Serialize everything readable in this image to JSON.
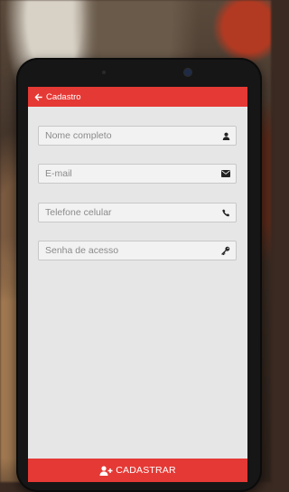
{
  "appbar": {
    "title": "Cadastro",
    "back_icon": "arrow-left-icon"
  },
  "form": {
    "fields": [
      {
        "placeholder": "Nome completo",
        "value": "",
        "icon": "user-icon"
      },
      {
        "placeholder": "E-mail",
        "value": "",
        "icon": "envelope-icon"
      },
      {
        "placeholder": "Telefone celular",
        "value": "",
        "icon": "phone-icon"
      },
      {
        "placeholder": "Senha de acesso",
        "value": "",
        "icon": "key-icon"
      }
    ]
  },
  "submit": {
    "label": "CADASTRAR",
    "icon": "user-plus-icon"
  },
  "colors": {
    "accent": "#e53935",
    "screen_bg": "#e6e6e6"
  }
}
